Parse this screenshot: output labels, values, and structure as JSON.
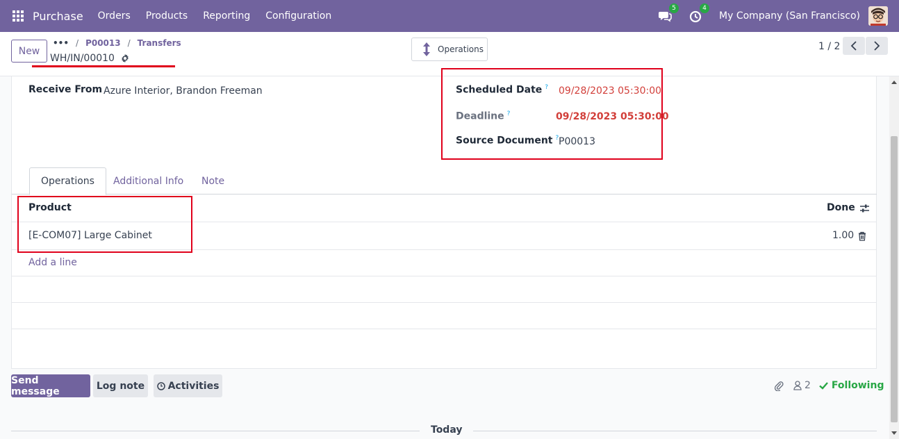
{
  "navbar": {
    "brand": "Purchase",
    "menu": [
      "Orders",
      "Products",
      "Reporting",
      "Configuration"
    ],
    "messages_count": "5",
    "activities_count": "4",
    "company": "My Company (San Francisco)"
  },
  "control": {
    "new_label": "New",
    "breadcrumb_dots": "•••",
    "breadcrumb": [
      "P00013",
      "Transfers"
    ],
    "record_name": "WH/IN/00010",
    "operations_button": "Operations",
    "pager": "1 / 2"
  },
  "form": {
    "receive_from_label": "Receive From",
    "receive_from_value": "Azure Interior, Brandon Freeman",
    "scheduled_date_label": "Scheduled Date",
    "scheduled_date_value": "09/28/2023 05:30:00",
    "deadline_label": "Deadline",
    "deadline_value": "09/28/2023 05:30:00",
    "source_document_label": "Source Document",
    "source_document_value": "P00013",
    "help_marker": "?"
  },
  "tabs": [
    "Operations",
    "Additional Info",
    "Note"
  ],
  "operations_table": {
    "columns": [
      "Product",
      "Done"
    ],
    "rows": [
      {
        "product": "[E-COM07] Large Cabinet",
        "done": "1.00"
      }
    ],
    "add_line": "Add a line"
  },
  "chatter": {
    "send_message": "Send message",
    "log_note": "Log note",
    "activities": "Activities",
    "followers_count": "2",
    "following": "Following",
    "today": "Today"
  },
  "colors": {
    "brand": "#71639e",
    "highlight_red": "#e0001b",
    "date_red": "#d23f3a",
    "following_green": "#28a745"
  }
}
